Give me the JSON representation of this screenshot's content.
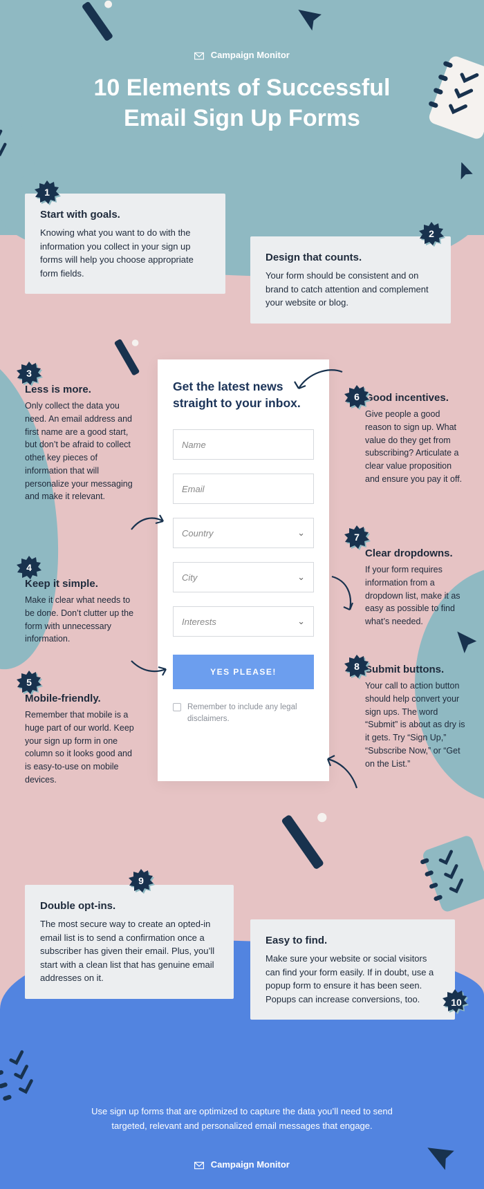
{
  "brand": "Campaign Monitor",
  "title_line1": "10 Elements of Successful",
  "title_line2": "Email Sign Up Forms",
  "tips": {
    "t1": {
      "num": "1",
      "title": "Start with goals.",
      "body": "Knowing what you want to do with the information you collect in your sign up forms will help you choose appropriate form fields."
    },
    "t2": {
      "num": "2",
      "title": "Design that counts.",
      "body": "Your form should be consistent and on brand to catch attention and complement your website or blog."
    },
    "t3": {
      "num": "3",
      "title": "Less is more.",
      "body": "Only collect the data you need. An email address and first name are a good start, but don’t be afraid to collect other key pieces of information that will personalize your messaging and make it relevant."
    },
    "t4": {
      "num": "4",
      "title": "Keep it simple.",
      "body": "Make it clear what needs to be done. Don’t clutter up the form with unnecessary information."
    },
    "t5": {
      "num": "5",
      "title": "Mobile-friendly.",
      "body": "Remember that mobile is a huge part of our world. Keep your sign up form in one column so it looks good and is easy-to-use on mobile devices."
    },
    "t6": {
      "num": "6",
      "title": "Good incentives.",
      "body": "Give people a good reason to sign up. What value do they get from subscribing? Articulate a clear value proposition and ensure you pay it off."
    },
    "t7": {
      "num": "7",
      "title": "Clear dropdowns.",
      "body": "If your form requires information from a dropdown list, make it as easy as possible to find what’s needed."
    },
    "t8": {
      "num": "8",
      "title": "Submit buttons.",
      "body": "Your call to action button should help convert your sign ups. The word “Submit” is about as dry is it gets. Try “Sign Up,” “Subscribe Now,” or “Get on the List.”"
    },
    "t9": {
      "num": "9",
      "title": "Double opt-ins.",
      "body": "The most secure way to create an opted-in email list is to send a confirmation once a subscriber has given their email. Plus, you’ll start with a clean list that has genuine email addresses on it."
    },
    "t10": {
      "num": "10",
      "title": "Easy to find.",
      "body": "Make sure your website or social visitors can find your form easily. If in doubt, use a popup form to ensure it has been seen. Popups can increase conversions, too."
    }
  },
  "form": {
    "heading": "Get the latest news straight to your inbox.",
    "fields": {
      "name": "Name",
      "email": "Email",
      "country": "Country",
      "city": "City",
      "interests": "Interests"
    },
    "submit": "YES PLEASE!",
    "disclaimer": "Remember to include any legal disclaimers."
  },
  "footer": "Use sign up forms that are optimized to capture the data you’ll need to send targeted, relevant and personalized email messages that engage."
}
